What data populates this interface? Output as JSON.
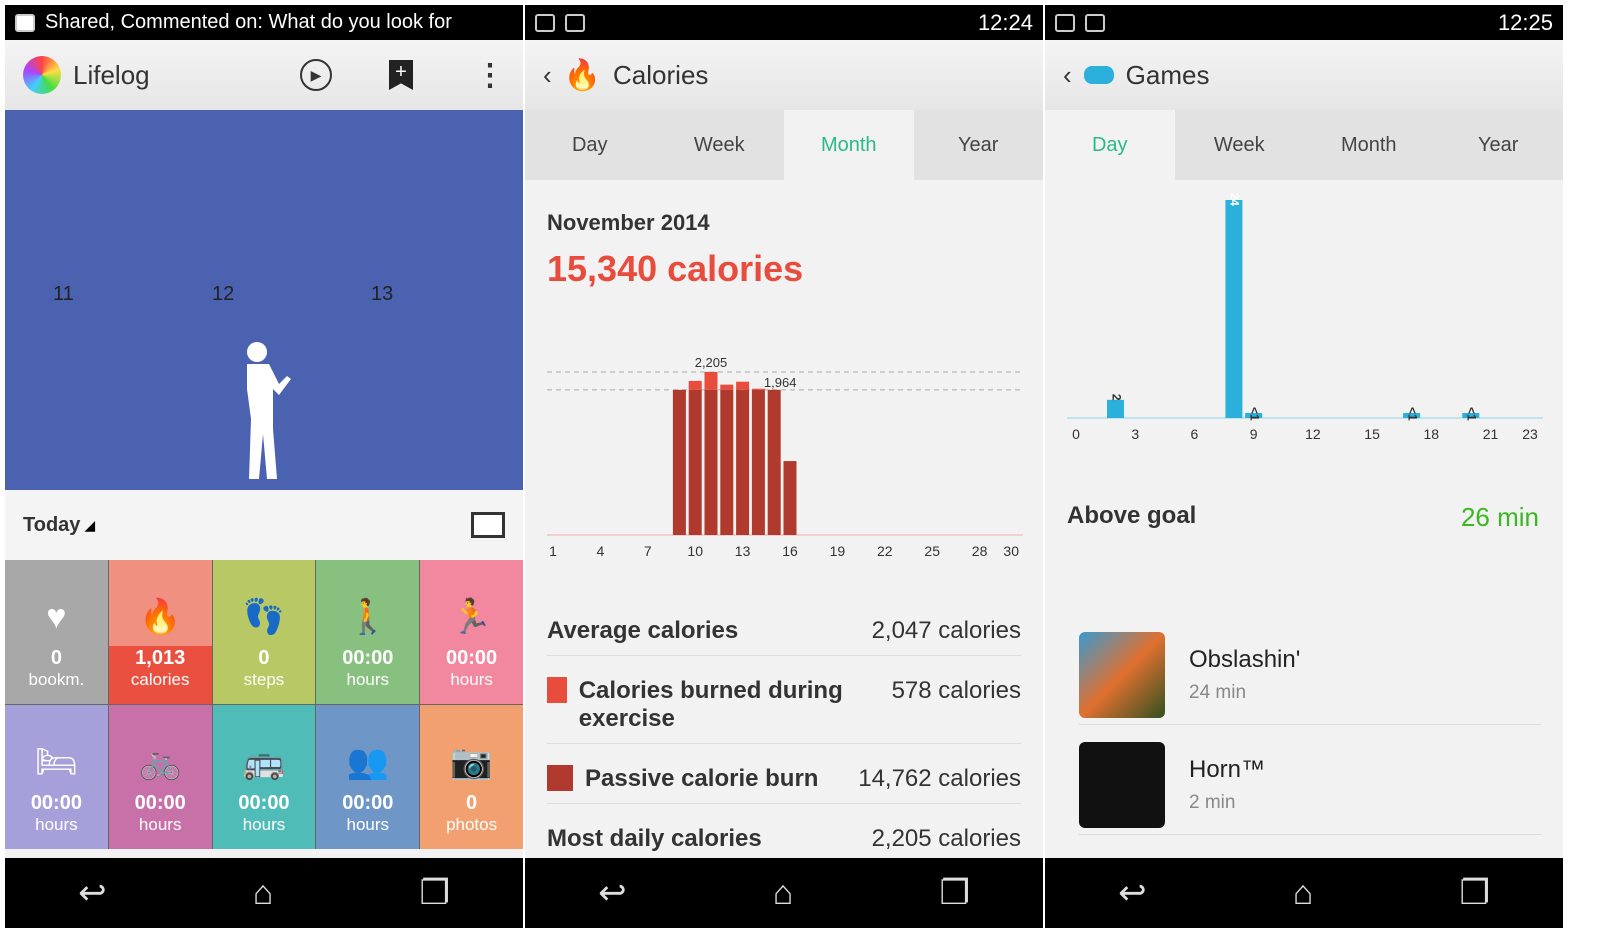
{
  "lifelog": {
    "status": {
      "notification": "Shared, Commented on: What do you look for",
      "icon": "google-plus-icon"
    },
    "title": "Lifelog",
    "timeline_labels": [
      "11",
      "12",
      "13"
    ],
    "period": "Today",
    "tiles": [
      {
        "value": "0",
        "unit": "bookm.",
        "icon": "bookmark-heart-icon",
        "color": "#a8a8a8"
      },
      {
        "value": "1,013",
        "unit": "calories",
        "icon": "flame-icon",
        "color": "#f09080",
        "highlight": "#e9503f"
      },
      {
        "value": "0",
        "unit": "steps",
        "icon": "footsteps-icon",
        "color": "#b8c864"
      },
      {
        "value": "00:00",
        "unit": "hours",
        "icon": "walking-icon",
        "color": "#88c080"
      },
      {
        "value": "00:00",
        "unit": "hours",
        "icon": "running-icon",
        "color": "#f288a0"
      },
      {
        "value": "00:00",
        "unit": "hours",
        "icon": "bed-icon",
        "color": "#a6a0da"
      },
      {
        "value": "00:00",
        "unit": "hours",
        "icon": "bicycle-icon",
        "color": "#c870a8"
      },
      {
        "value": "00:00",
        "unit": "hours",
        "icon": "bus-icon",
        "color": "#50bcb8"
      },
      {
        "value": "00:00",
        "unit": "hours",
        "icon": "people-icon",
        "color": "#6e96c6"
      },
      {
        "value": "0",
        "unit": "photos",
        "icon": "camera-icon",
        "color": "#f2a070"
      }
    ]
  },
  "calories": {
    "status": {
      "time": "12:24"
    },
    "title": "Calories",
    "tabs": [
      "Day",
      "Week",
      "Month",
      "Year"
    ],
    "active_tab": "Month",
    "month": "November 2014",
    "total": "15,340 calories",
    "stats": [
      {
        "label": "Average calories",
        "value": "2,047 calories"
      },
      {
        "label": "Calories burned during exercise",
        "value": "578 calories",
        "color": "#e84c3d"
      },
      {
        "label": "Passive calorie burn",
        "value": "14,762 calories",
        "color": "#b03a2e"
      },
      {
        "label": "Most daily calories",
        "value": "2,205 calories"
      }
    ]
  },
  "games": {
    "status": {
      "time": "12:25"
    },
    "title": "Games",
    "tabs": [
      "Day",
      "Week",
      "Month",
      "Year"
    ],
    "active_tab": "Day",
    "summary_label": "Above goal",
    "summary_value": "26 min",
    "apps": [
      {
        "name": "Obslashin'",
        "time": "24 min"
      },
      {
        "name": "Horn™",
        "time": "2 min"
      }
    ]
  },
  "chart_data": [
    {
      "type": "bar",
      "stacked": true,
      "categories": [
        1,
        2,
        3,
        4,
        5,
        6,
        7,
        8,
        9,
        10,
        11,
        12,
        13,
        14,
        15,
        16,
        17,
        18,
        19,
        20,
        21,
        22,
        23,
        24,
        25,
        26,
        27,
        28,
        29,
        30
      ],
      "x_ticks": [
        "1",
        "4",
        "7",
        "10",
        "13",
        "16",
        "19",
        "22",
        "25",
        "28",
        "30"
      ],
      "series": [
        {
          "name": "Passive calorie burn",
          "color": "#b03a2e",
          "values": [
            0,
            0,
            0,
            0,
            0,
            0,
            0,
            0,
            1964,
            1964,
            1964,
            1964,
            1964,
            1964,
            1964,
            1000,
            0,
            0,
            0,
            0,
            0,
            0,
            0,
            0,
            0,
            0,
            0,
            0,
            0,
            0
          ]
        },
        {
          "name": "Calories burned during exercise",
          "color": "#e84c3d",
          "values": [
            0,
            0,
            0,
            0,
            0,
            0,
            0,
            0,
            0,
            120,
            241,
            70,
            110,
            15,
            0,
            0,
            0,
            0,
            0,
            0,
            0,
            0,
            0,
            0,
            0,
            0,
            0,
            0,
            0,
            0
          ]
        }
      ],
      "annotations": [
        {
          "x": 11,
          "label": "2,205"
        },
        {
          "x": 15,
          "label": "1,964"
        }
      ],
      "reference_lines": [
        2205,
        1964
      ],
      "ylim": [
        0,
        2205
      ]
    },
    {
      "type": "bar",
      "categories": [
        0,
        1,
        2,
        3,
        4,
        5,
        6,
        7,
        8,
        9,
        10,
        11,
        12,
        13,
        14,
        15,
        16,
        17,
        18,
        19,
        20,
        21,
        22,
        23
      ],
      "x_ticks": [
        "0",
        "3",
        "6",
        "9",
        "12",
        "15",
        "18",
        "21",
        "23"
      ],
      "values": [
        0,
        0,
        2,
        0,
        0,
        0,
        0,
        0,
        24,
        0.5,
        0,
        0,
        0,
        0,
        0,
        0,
        0,
        0.5,
        0,
        0,
        0.5,
        0,
        0,
        0
      ],
      "data_labels": {
        "2": "2",
        "8": "24",
        "9": "<1",
        "17": "<1",
        "20": "<1"
      },
      "color": "#2bb0dc",
      "ylim": [
        0,
        24
      ]
    }
  ]
}
